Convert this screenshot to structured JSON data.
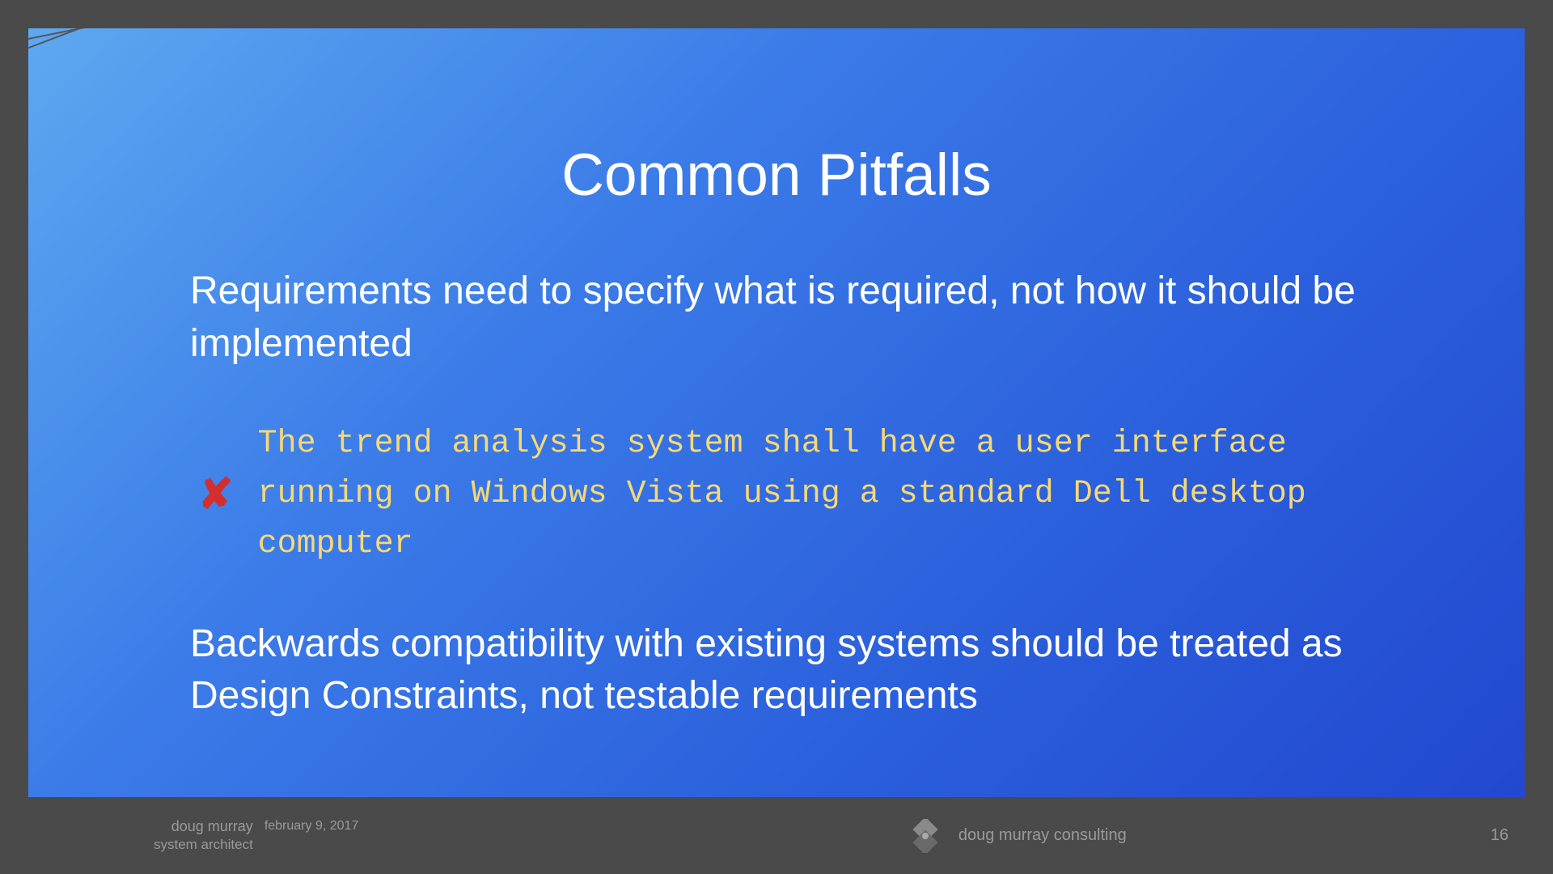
{
  "slide": {
    "title": "Common Pitfalls",
    "paragraph1": "Requirements need to specify what is required, not how it should be implemented",
    "exampleText": "The trend analysis system shall have a user interface running on Windows Vista using a standard Dell desktop computer",
    "paragraph2": "Backwards compatibility with existing systems should be treated as Design Constraints, not testable requirements"
  },
  "footer": {
    "authorName": "doug murray",
    "authorTitle": "system architect",
    "date": "february 9, 2017",
    "companyName": "doug murray consulting",
    "pageNumber": "16"
  }
}
